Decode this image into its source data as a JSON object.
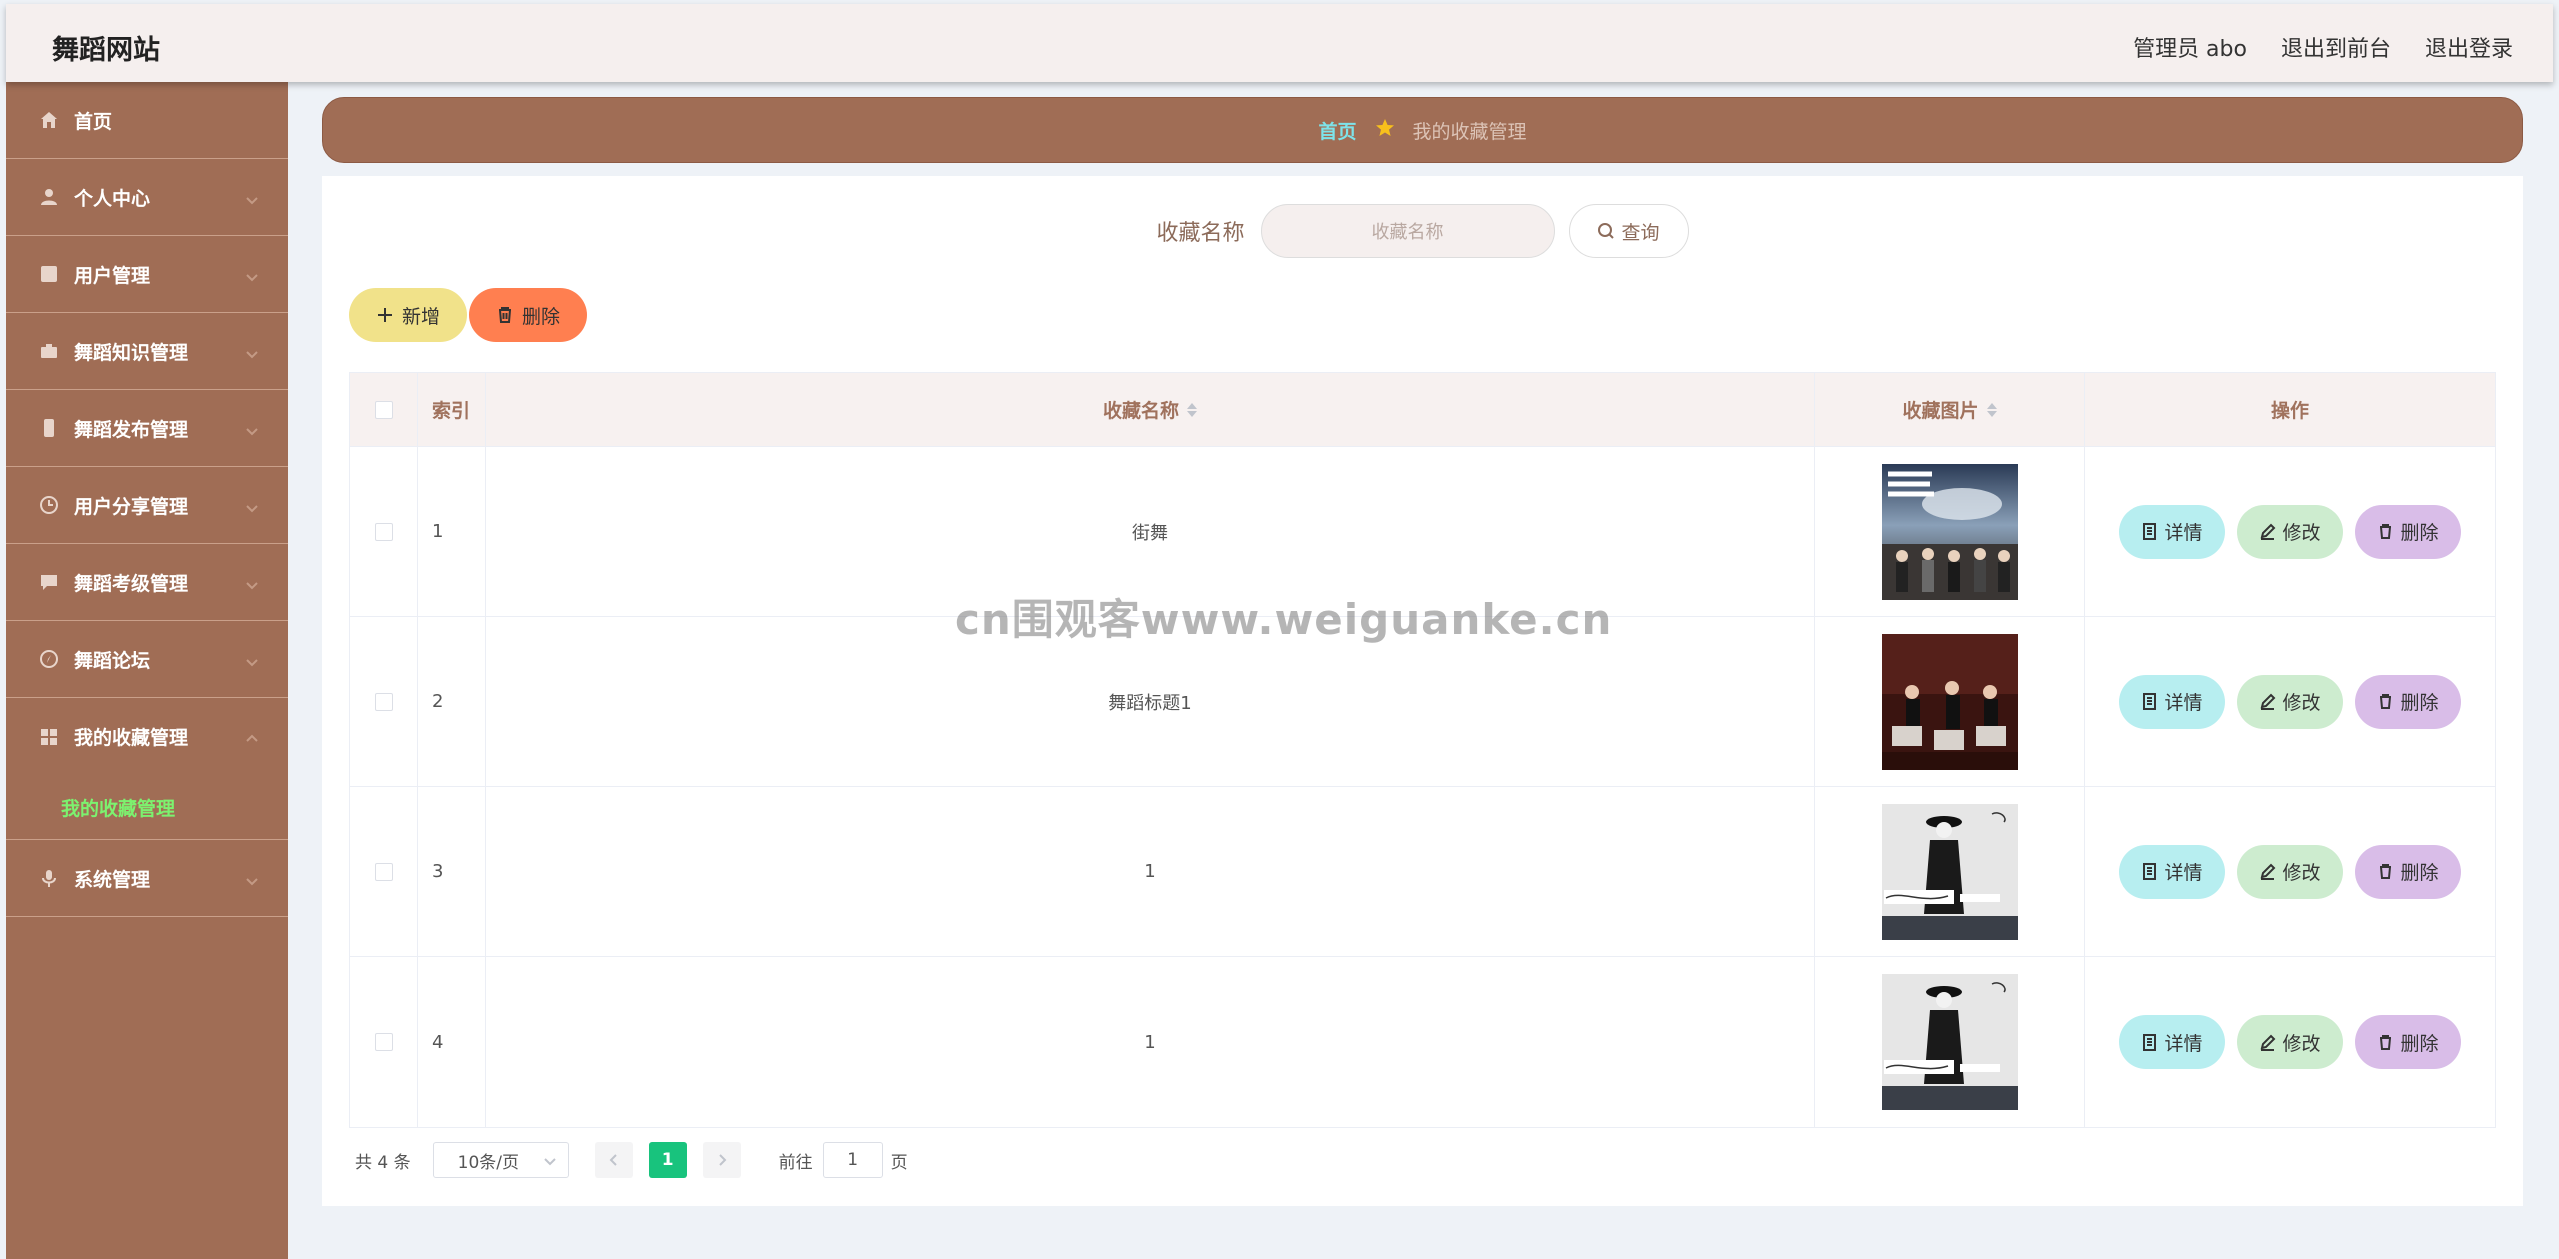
{
  "header": {
    "logo": "舞蹈网站",
    "user": "管理员 abo",
    "front": "退出到前台",
    "logout": "退出登录"
  },
  "sidebar": {
    "items": [
      {
        "label": "首页",
        "icon": "home-icon"
      },
      {
        "label": "个人中心",
        "icon": "user-icon"
      },
      {
        "label": "用户管理",
        "icon": "checkbox-icon"
      },
      {
        "label": "舞蹈知识管理",
        "icon": "briefcase-icon"
      },
      {
        "label": "舞蹈发布管理",
        "icon": "phone-icon"
      },
      {
        "label": "用户分享管理",
        "icon": "clock-icon"
      },
      {
        "label": "舞蹈考级管理",
        "icon": "chat-icon"
      },
      {
        "label": "舞蹈论坛",
        "icon": "compass-icon"
      },
      {
        "label": "我的收藏管理",
        "icon": "grid-icon"
      },
      {
        "label": "系统管理",
        "icon": "mic-icon"
      }
    ],
    "submenu": "我的收藏管理"
  },
  "breadcrumb": {
    "home": "首页",
    "current": "我的收藏管理"
  },
  "search": {
    "label": "收藏名称",
    "placeholder": "收藏名称",
    "button": "查询"
  },
  "actions": {
    "add": "新增",
    "delete": "删除"
  },
  "table": {
    "columns": [
      "索引",
      "收藏名称",
      "收藏图片",
      "操作"
    ],
    "rows": [
      {
        "index": "1",
        "name": "街舞"
      },
      {
        "index": "2",
        "name": "舞蹈标题1"
      },
      {
        "index": "3",
        "name": "1"
      },
      {
        "index": "4",
        "name": "1"
      }
    ],
    "ops": {
      "detail": "详情",
      "edit": "修改",
      "delete": "删除"
    }
  },
  "pager": {
    "total": "共 4 条",
    "size": "10条/页",
    "page": "1",
    "goto": "前往",
    "goto_value": "1",
    "unit": "页"
  },
  "watermark": "cn围观客www.weiguanke.cn",
  "colors": {
    "sidebar": "#a06d55",
    "active": "#18c37d",
    "submenu": "#7cf26f"
  }
}
